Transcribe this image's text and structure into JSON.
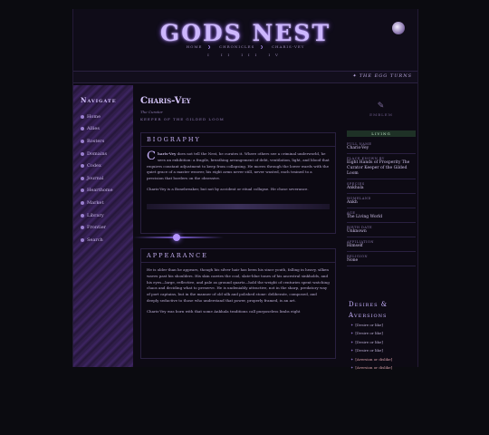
{
  "header": {
    "logo": "GODS NEST",
    "crumbs": [
      "HOME",
      "CHRONICLES",
      "CHARIS-VEY"
    ],
    "pager": [
      "I",
      "II",
      "III",
      "IV"
    ],
    "egg_link": "✦ THE EGG TURNS"
  },
  "sidebar": {
    "title": "Navigate",
    "items": [
      "Home",
      "Allies",
      "Rosters",
      "Domains",
      "Codex",
      "Journal",
      "Hearthome",
      "Market",
      "Library",
      "Frontier",
      "Search"
    ]
  },
  "profile": {
    "name": "Charis-Vey",
    "subtitle": "The Curator",
    "tagline": "KEEPER OF THE GILDED LOOM",
    "biography_title": "BIOGRAPHY",
    "biography_dropcap": "C",
    "biography_p1_bold": "haris-Vey",
    "biography_p1": " does not tell the Nest, he curates it. Where others see a criminal underworld, he sees an exhibition: a fragile, breathing arrangement of debt, ventilation, light, and blood that requires constant adjustment to keep from collapsing. He moves through the lower wards with the quiet grace of a master weaver, his eight arms never still, never wasted, each trained to a precision that borders on the obsessive.",
    "biography_p2": "Charis-Vey is a Bonebreaker, but not by accident or ritual collapse. He chose severance.",
    "appearance_title": "APPEARANCE",
    "appearance_p1": "He is older than he appears, though his silver hair has been his since youth, falling in heavy, silken waves past his shoulders. His skin carries the cool, slate-blue tones of his ancestral sinkholds, and his eyes—large, reflective, and pale as ground quartz—hold the weight of centuries spent watching chaos and deciding what to preserve. He is undeniably attractive, not in the sharp, predatory way of port captains, but in the manner of old silk and polished stone: deliberate, composed, and deeply seductive to those who understand that power, properly framed, is an art.",
    "appearance_p2": "Charis-Vey was born with that some Ankhala traditions call purposeless limbs eight"
  },
  "info": {
    "emblem_label": "EMBLEM",
    "status": "LIVING",
    "fields": [
      {
        "label": "FULL NAME",
        "value": "Charis-Vey"
      },
      {
        "label": "PLACE KNOWN BY",
        "value": "Eight Hands of Prosperity The Curator Keeper of the Gilded Loom"
      },
      {
        "label": "SPECIES",
        "value": "Ankhala"
      },
      {
        "label": "HOMELAND",
        "value": "Ankh"
      },
      {
        "label": "AGE",
        "value": "The Living World"
      },
      {
        "label": "BIRTH DATE",
        "value": "Unknown"
      },
      {
        "label": "AFFILIATION",
        "value": "Himself"
      },
      {
        "label": "RELIGION",
        "value": "None"
      }
    ]
  },
  "desires": {
    "title": "Desires & Aversions",
    "items": [
      {
        "text": "[Desire or like]",
        "type": "desire"
      },
      {
        "text": "[Desire or like]",
        "type": "desire"
      },
      {
        "text": "[Desire or like]",
        "type": "desire"
      },
      {
        "text": "[Desire or like]",
        "type": "desire"
      },
      {
        "text": "[Aversion or dislike]",
        "type": "aversion"
      },
      {
        "text": "[Aversion or dislike]",
        "type": "aversion"
      }
    ]
  }
}
